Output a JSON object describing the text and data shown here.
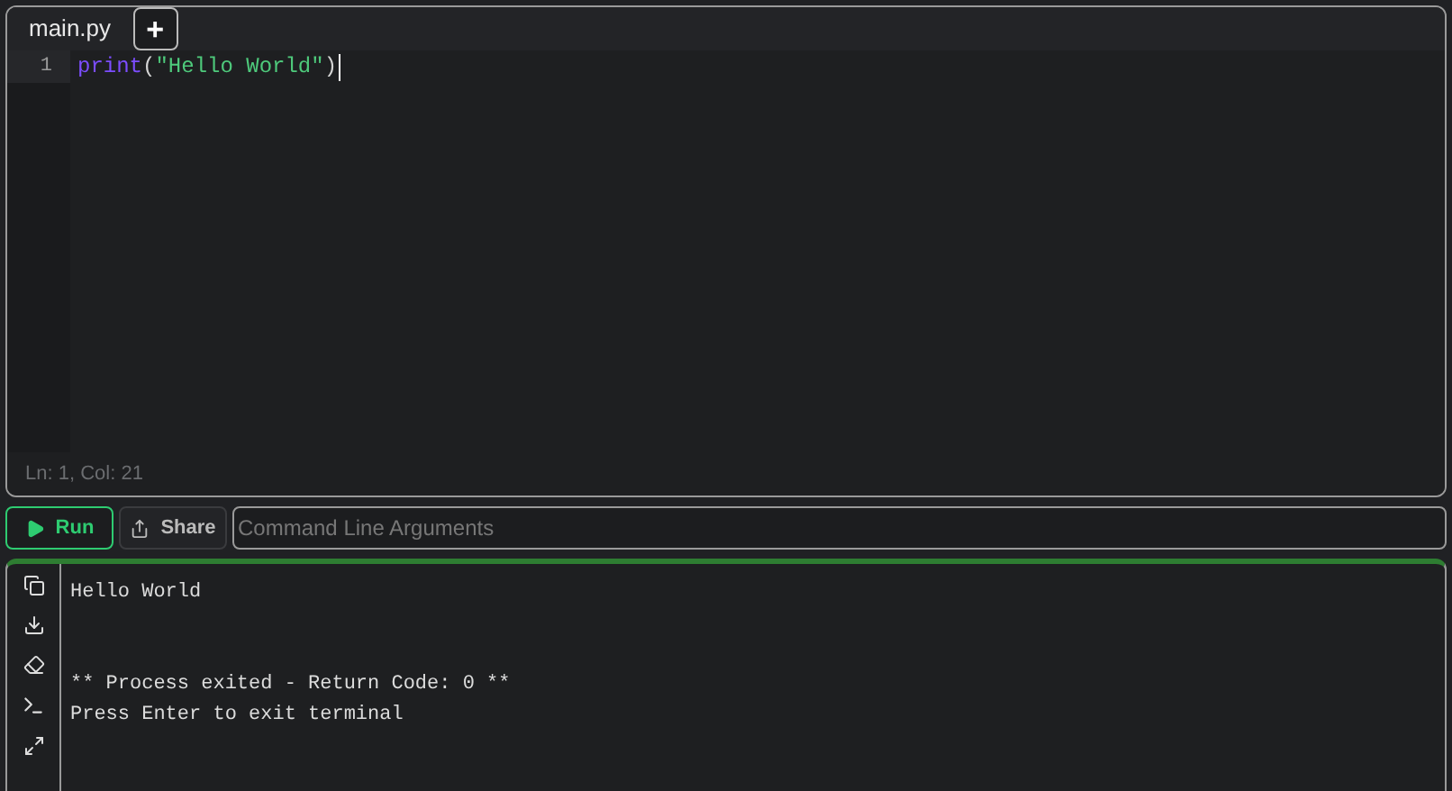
{
  "tabs": [
    {
      "label": "main.py",
      "selected": true
    }
  ],
  "new_tab_button": "+",
  "editor": {
    "lines": [
      {
        "number": "1",
        "tokens": [
          {
            "kind": "keyword",
            "text": "print"
          },
          {
            "kind": "punct",
            "text": "("
          },
          {
            "kind": "string",
            "text": "\"Hello World\""
          },
          {
            "kind": "punct",
            "text": ")"
          }
        ]
      }
    ]
  },
  "status": {
    "position": "Ln: 1,  Col: 21"
  },
  "toolbar": {
    "run": "Run",
    "share": "Share",
    "arguments_placeholder": "Command Line Arguments"
  },
  "terminal": {
    "blocks": [
      [
        "Hello World"
      ],
      [
        "** Process exited - Return Code: 0 **",
        "Press Enter to exit terminal"
      ]
    ]
  }
}
